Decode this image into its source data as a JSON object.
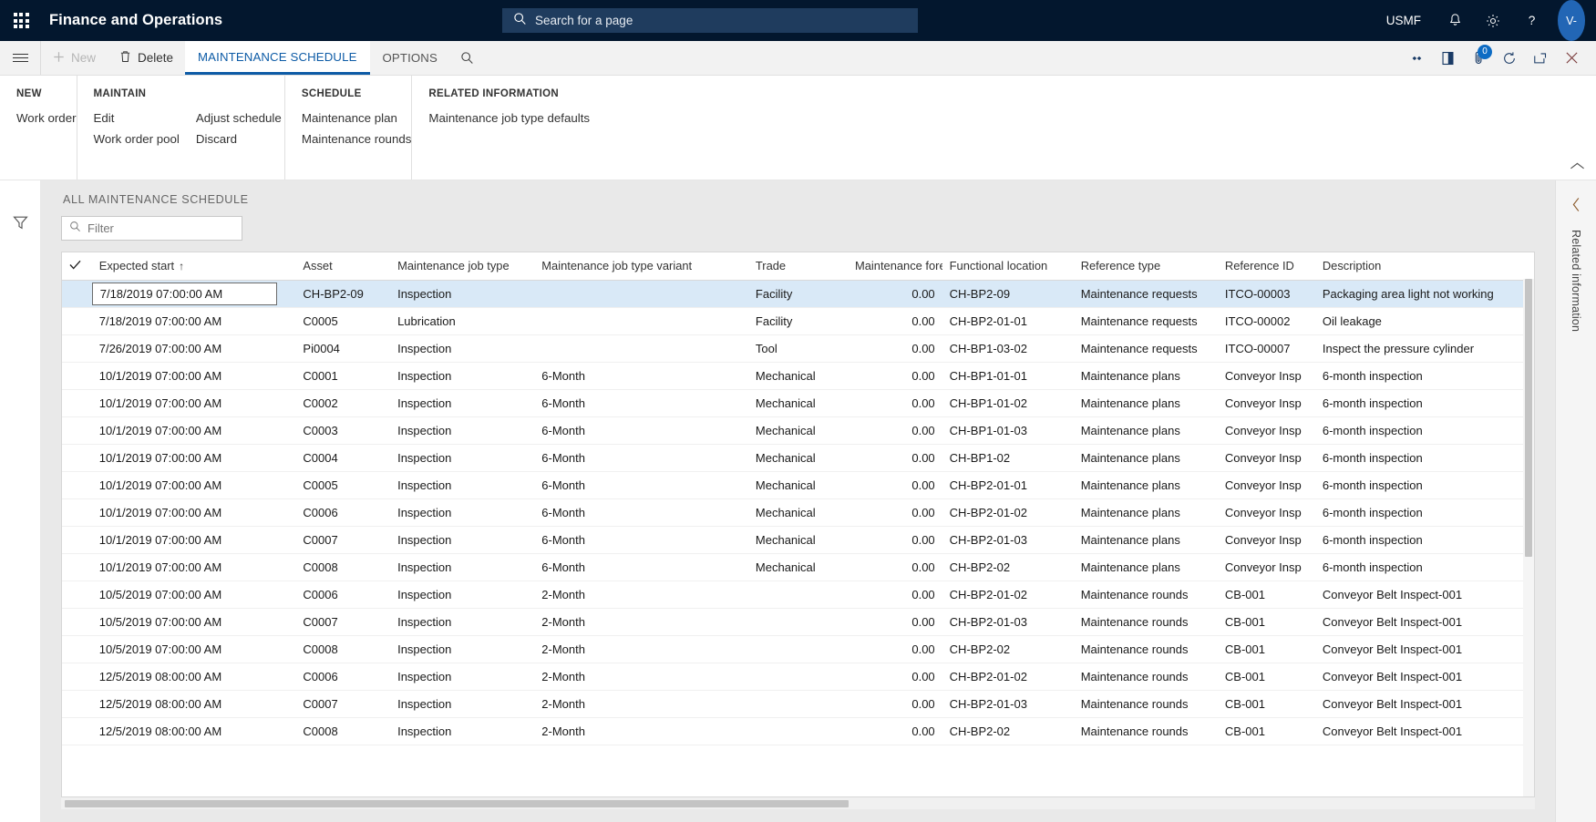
{
  "topbar": {
    "waffle_icon": "app-launcher-icon",
    "app_title": "Finance and Operations",
    "search": {
      "placeholder": "Search for a page",
      "icon": "search-icon"
    },
    "company": "USMF",
    "icons": [
      "notifications-bell-icon",
      "settings-gear-icon",
      "help-question-icon"
    ],
    "avatar_initials": "V-"
  },
  "commandbar": {
    "hamburger": "navigation-menu-icon",
    "new_label": "New",
    "new_enabled": false,
    "delete_label": "Delete",
    "tabs": [
      {
        "label": "MAINTENANCE SCHEDULE",
        "active": true
      },
      {
        "label": "OPTIONS",
        "active": false
      }
    ],
    "search_icon": "search-icon",
    "right_icons": [
      {
        "name": "share-icon"
      },
      {
        "name": "office-export-icon"
      },
      {
        "name": "attachments-icon",
        "badge": "0"
      },
      {
        "name": "refresh-icon"
      },
      {
        "name": "popout-icon"
      },
      {
        "name": "close-icon"
      }
    ]
  },
  "actionpane": {
    "groups": [
      {
        "title": "NEW",
        "columns": [
          [
            "Work order"
          ]
        ]
      },
      {
        "title": "MAINTAIN",
        "columns": [
          [
            "Edit",
            "Work order pool"
          ],
          [
            "Adjust schedule",
            "Discard"
          ]
        ]
      },
      {
        "title": "SCHEDULE",
        "columns": [
          [
            "Maintenance plan",
            "Maintenance rounds"
          ]
        ]
      },
      {
        "title": "RELATED INFORMATION",
        "columns": [
          [
            "Maintenance job type defaults"
          ]
        ]
      }
    ],
    "collapse_icon": "chevron-up-icon"
  },
  "leftrail": {
    "filter_icon": "filter-funnel-icon"
  },
  "rightrail": {
    "collapse_icon": "chevron-left-icon",
    "label": "Related information"
  },
  "list": {
    "caption": "ALL MAINTENANCE SCHEDULE",
    "filter": {
      "placeholder": "Filter",
      "value": "",
      "icon": "search-icon"
    }
  },
  "grid": {
    "select_all_icon": "checkmark-icon",
    "sort_indicator": "↑",
    "columns": [
      "Expected start",
      "Asset",
      "Maintenance job type",
      "Maintenance job type variant",
      "Trade",
      "Maintenance forecast...",
      "Functional location",
      "Reference type",
      "Reference ID",
      "Description"
    ],
    "rows": [
      {
        "selected": true,
        "editing": true,
        "expected_start": "7/18/2019 07:00:00 AM",
        "asset": "CH-BP2-09",
        "asset_link": true,
        "job_type": "Inspection",
        "job_type_link": true,
        "variant": "",
        "trade": "Facility",
        "trade_link": true,
        "forecast": "0.00",
        "functional_location": "CH-BP2-09",
        "functional_location_link": true,
        "reference_type": "Maintenance requests",
        "reference_id": "ITCO-00003",
        "description": "Packaging area light not working"
      },
      {
        "expected_start": "7/18/2019 07:00:00 AM",
        "asset": "C0005",
        "job_type": "Lubrication",
        "variant": "",
        "trade": "Facility",
        "forecast": "0.00",
        "functional_location": "CH-BP2-01-01",
        "reference_type": "Maintenance requests",
        "reference_id": "ITCO-00002",
        "description": "Oil leakage"
      },
      {
        "expected_start": "7/26/2019 07:00:00 AM",
        "asset": "Pi0004",
        "job_type": "Inspection",
        "variant": "",
        "trade": "Tool",
        "forecast": "0.00",
        "functional_location": "CH-BP1-03-02",
        "reference_type": "Maintenance requests",
        "reference_id": "ITCO-00007",
        "description": "Inspect the pressure cylinder"
      },
      {
        "expected_start": "10/1/2019 07:00:00 AM",
        "asset": "C0001",
        "job_type": "Inspection",
        "variant": "6-Month",
        "trade": "Mechanical",
        "forecast": "0.00",
        "functional_location": "CH-BP1-01-01",
        "reference_type": "Maintenance plans",
        "reference_id": "Conveyor Insp",
        "description": "6-month inspection"
      },
      {
        "expected_start": "10/1/2019 07:00:00 AM",
        "asset": "C0002",
        "job_type": "Inspection",
        "variant": "6-Month",
        "trade": "Mechanical",
        "forecast": "0.00",
        "functional_location": "CH-BP1-01-02",
        "reference_type": "Maintenance plans",
        "reference_id": "Conveyor Insp",
        "description": "6-month inspection"
      },
      {
        "expected_start": "10/1/2019 07:00:00 AM",
        "asset": "C0003",
        "job_type": "Inspection",
        "variant": "6-Month",
        "trade": "Mechanical",
        "forecast": "0.00",
        "functional_location": "CH-BP1-01-03",
        "reference_type": "Maintenance plans",
        "reference_id": "Conveyor Insp",
        "description": "6-month inspection"
      },
      {
        "expected_start": "10/1/2019 07:00:00 AM",
        "asset": "C0004",
        "job_type": "Inspection",
        "variant": "6-Month",
        "trade": "Mechanical",
        "forecast": "0.00",
        "functional_location": "CH-BP1-02",
        "reference_type": "Maintenance plans",
        "reference_id": "Conveyor Insp",
        "description": "6-month inspection"
      },
      {
        "expected_start": "10/1/2019 07:00:00 AM",
        "asset": "C0005",
        "job_type": "Inspection",
        "variant": "6-Month",
        "trade": "Mechanical",
        "forecast": "0.00",
        "functional_location": "CH-BP2-01-01",
        "reference_type": "Maintenance plans",
        "reference_id": "Conveyor Insp",
        "description": "6-month inspection"
      },
      {
        "expected_start": "10/1/2019 07:00:00 AM",
        "asset": "C0006",
        "job_type": "Inspection",
        "variant": "6-Month",
        "trade": "Mechanical",
        "forecast": "0.00",
        "functional_location": "CH-BP2-01-02",
        "reference_type": "Maintenance plans",
        "reference_id": "Conveyor Insp",
        "description": "6-month inspection"
      },
      {
        "expected_start": "10/1/2019 07:00:00 AM",
        "asset": "C0007",
        "job_type": "Inspection",
        "variant": "6-Month",
        "trade": "Mechanical",
        "forecast": "0.00",
        "functional_location": "CH-BP2-01-03",
        "reference_type": "Maintenance plans",
        "reference_id": "Conveyor Insp",
        "description": "6-month inspection"
      },
      {
        "expected_start": "10/1/2019 07:00:00 AM",
        "asset": "C0008",
        "job_type": "Inspection",
        "variant": "6-Month",
        "trade": "Mechanical",
        "forecast": "0.00",
        "functional_location": "CH-BP2-02",
        "reference_type": "Maintenance plans",
        "reference_id": "Conveyor Insp",
        "description": "6-month inspection"
      },
      {
        "expected_start": "10/5/2019 07:00:00 AM",
        "asset": "C0006",
        "job_type": "Inspection",
        "variant": "2-Month",
        "trade": "",
        "forecast": "0.00",
        "functional_location": "CH-BP2-01-02",
        "reference_type": "Maintenance rounds",
        "reference_id": "CB-001",
        "description": "Conveyor Belt Inspect-001"
      },
      {
        "expected_start": "10/5/2019 07:00:00 AM",
        "asset": "C0007",
        "job_type": "Inspection",
        "variant": "2-Month",
        "trade": "",
        "forecast": "0.00",
        "functional_location": "CH-BP2-01-03",
        "reference_type": "Maintenance rounds",
        "reference_id": "CB-001",
        "description": "Conveyor Belt Inspect-001"
      },
      {
        "expected_start": "10/5/2019 07:00:00 AM",
        "asset": "C0008",
        "job_type": "Inspection",
        "variant": "2-Month",
        "trade": "",
        "forecast": "0.00",
        "functional_location": "CH-BP2-02",
        "reference_type": "Maintenance rounds",
        "reference_id": "CB-001",
        "description": "Conveyor Belt Inspect-001"
      },
      {
        "expected_start": "12/5/2019 08:00:00 AM",
        "asset": "C0006",
        "job_type": "Inspection",
        "variant": "2-Month",
        "trade": "",
        "forecast": "0.00",
        "functional_location": "CH-BP2-01-02",
        "reference_type": "Maintenance rounds",
        "reference_id": "CB-001",
        "description": "Conveyor Belt Inspect-001"
      },
      {
        "expected_start": "12/5/2019 08:00:00 AM",
        "asset": "C0007",
        "job_type": "Inspection",
        "variant": "2-Month",
        "trade": "",
        "forecast": "0.00",
        "functional_location": "CH-BP2-01-03",
        "reference_type": "Maintenance rounds",
        "reference_id": "CB-001",
        "description": "Conveyor Belt Inspect-001"
      },
      {
        "expected_start": "12/5/2019 08:00:00 AM",
        "asset": "C0008",
        "job_type": "Inspection",
        "variant": "2-Month",
        "trade": "",
        "forecast": "0.00",
        "functional_location": "CH-BP2-02",
        "reference_type": "Maintenance rounds",
        "reference_id": "CB-001",
        "description": "Conveyor Belt Inspect-001"
      }
    ]
  },
  "colors": {
    "topbar_bg": "#03172e",
    "accent_blue": "#0d5ba6",
    "link_blue": "#1264a3",
    "selected_row": "#d9e9f7",
    "page_bg": "#e9e9e9"
  }
}
